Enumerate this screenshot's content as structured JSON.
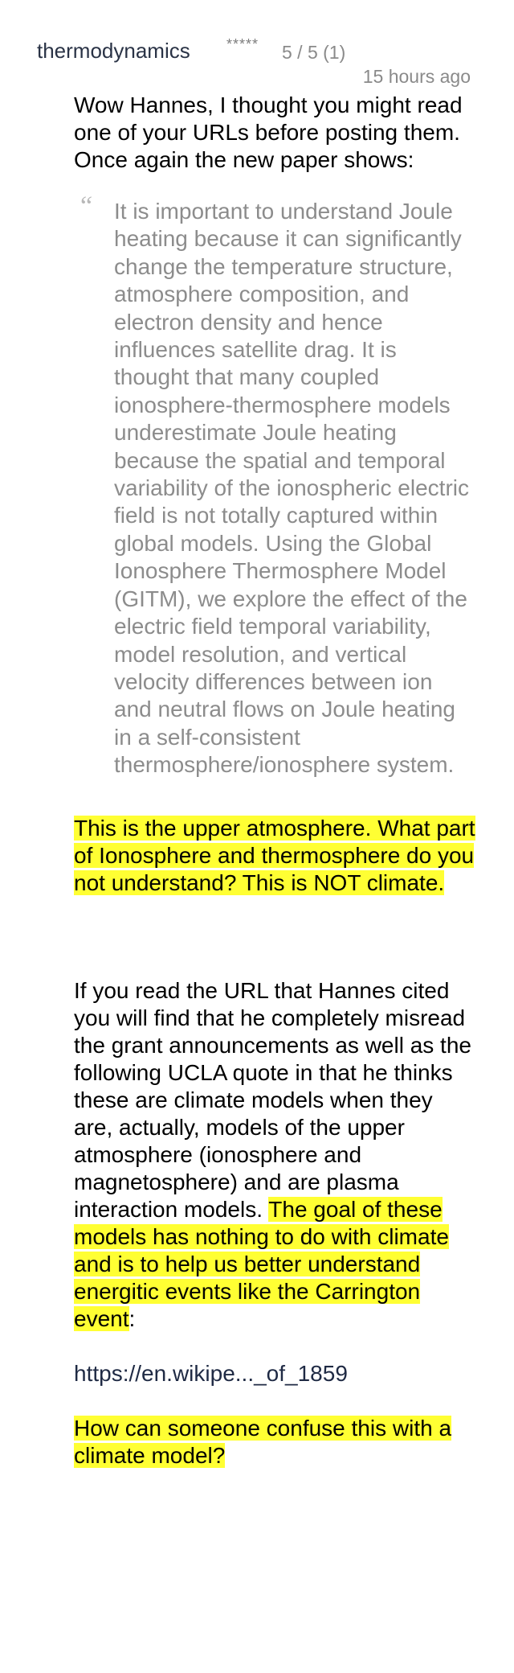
{
  "comment": {
    "username": "thermodynamics",
    "stars": "*****",
    "rating": "5 / 5 (1)",
    "timestamp": "15 hours ago",
    "intro": "Wow Hannes, I thought you might read one of your URLs before posting them. Once again the new paper shows:",
    "quote_mark": "“",
    "quote": "It is important to understand Joule heating because it can significantly change the temperature structure, atmosphere composition, and electron density and hence influences satellite drag. It is thought that many coupled ionosphere-thermosphere models underestimate Joule heating because the spatial and temporal variability of the ionospheric electric field is not totally captured within global models. Using the Global Ionosphere Thermosphere Model (GITM), we explore the effect of the electric field temporal variability, model resolution, and vertical velocity differences between ion and neutral flows on Joule heating in a self-consistent thermosphere/ionosphere system.",
    "highlight_1": "This is the upper atmosphere. What part of Ionosphere and thermosphere do you not understand? This is NOT climate.",
    "para_2_plain": "If you read the URL that Hannes cited you will find that he completely misread the grant announcements as well as the following UCLA quote in that he thinks these are climate models when they are, actually, models of the upper atmosphere (ionosphere and magnetosphere) and are plasma interaction models. ",
    "para_2_highlight": "The goal of these models has nothing to do with climate and is to help us better understand energitic events like the Carrington event",
    "para_2_end": ":",
    "link_text": "https://en.wikipe..._of_1859",
    "highlight_2": "How can someone confuse this with a climate model?"
  },
  "colors": {
    "highlight": "#ffff33",
    "username": "#2a3346",
    "meta": "#8a8a8a",
    "quote_text": "#8c8c8c"
  }
}
